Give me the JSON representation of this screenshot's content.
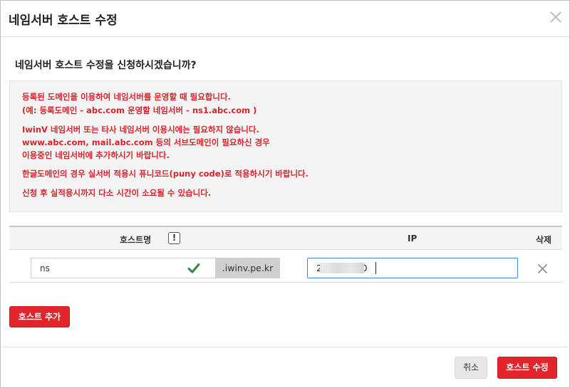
{
  "header": {
    "title": "네임서버 호스트 수정",
    "close_icon": "close-icon"
  },
  "question": "네임서버 호스트 수정을 신청하시겠습니까?",
  "notice": {
    "lines": [
      "등록된 도메인을 이용하여 네임서버를 운영할 때 필요합니다.",
      "(예: 등록도메인 - abc.com 운영할 네임서버 - ns1.abc.com )",
      "IwinV 네임서버 또는 타사 네임서버 이용시에는 필요하지 않습니다.",
      "www.abc.com, mail.abc.com 등의 서브도메인이 필요하신 경우",
      "이용중인 네임서버에 추가하시기 바랍니다.",
      "한글도메인의 경우 실서버 적용시 퓨니코드(puny code)로 적용하시기 바랍니다.",
      "신청 후 실적용시까지 다소 시간이 소요될 수 있습니다."
    ],
    "color": "#d8242a"
  },
  "table": {
    "headers": {
      "host": "호스트명",
      "hint": "!",
      "ip": "IP",
      "delete": "삭제"
    },
    "row": {
      "host_value": "ns",
      "host_valid_icon": "check-icon",
      "domain_suffix": ".iwinv.pe.kr",
      "ip_value": "2            10",
      "delete_icon": "close-icon"
    }
  },
  "buttons": {
    "add_host": "호스트 추가",
    "cancel": "취소",
    "submit": "호스트 수정"
  },
  "colors": {
    "accent": "#e2242b",
    "focus": "#3b86d8",
    "valid": "#2e8b3e"
  }
}
